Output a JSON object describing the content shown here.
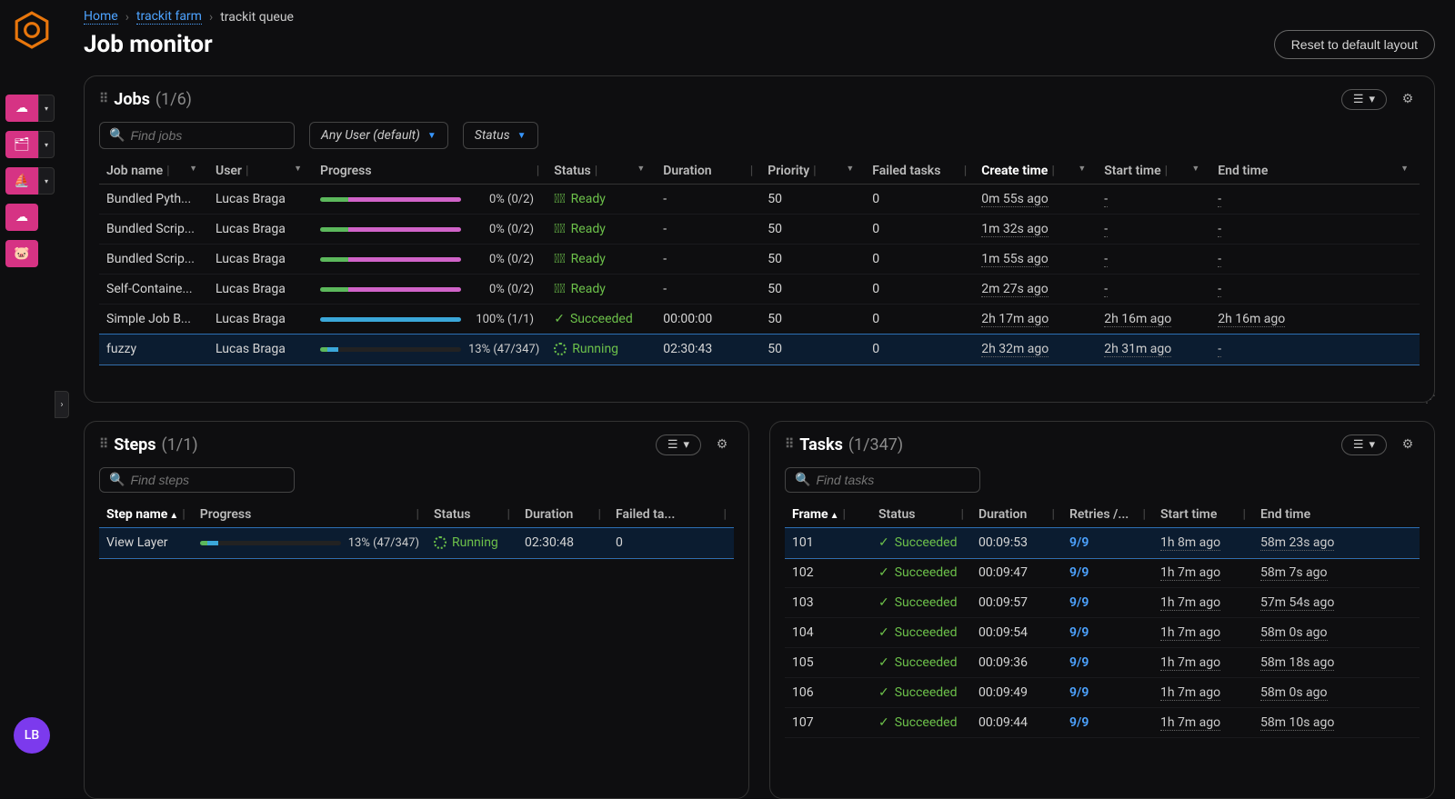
{
  "breadcrumb": {
    "home": "Home",
    "farm": "trackit farm",
    "queue": "trackit queue"
  },
  "page_title": "Job monitor",
  "reset_button": "Reset to default layout",
  "avatar_initials": "LB",
  "jobs_panel": {
    "title": "Jobs",
    "count": "(1/6)",
    "search_placeholder": "Find jobs",
    "user_filter": "Any User (default)",
    "status_filter": "Status",
    "cols": {
      "name": "Job name",
      "user": "User",
      "progress": "Progress",
      "status": "Status",
      "duration": "Duration",
      "priority": "Priority",
      "failed": "Failed tasks",
      "create": "Create time",
      "start": "Start time",
      "end": "End time"
    },
    "rows": [
      {
        "name": "Bundled Pyth...",
        "user": "Lucas Braga",
        "prog": "0% (0/2)",
        "status": "Ready",
        "icon": "ready",
        "bar": {
          "g": 20,
          "p": 80,
          "b": 0
        },
        "dur": "-",
        "pri": "50",
        "fail": "0",
        "create": "0m 55s ago",
        "start": "-",
        "end": "-"
      },
      {
        "name": "Bundled Scrip...",
        "user": "Lucas Braga",
        "prog": "0% (0/2)",
        "status": "Ready",
        "icon": "ready",
        "bar": {
          "g": 20,
          "p": 80,
          "b": 0
        },
        "dur": "-",
        "pri": "50",
        "fail": "0",
        "create": "1m 32s ago",
        "start": "-",
        "end": "-"
      },
      {
        "name": "Bundled Scrip...",
        "user": "Lucas Braga",
        "prog": "0% (0/2)",
        "status": "Ready",
        "icon": "ready",
        "bar": {
          "g": 20,
          "p": 80,
          "b": 0
        },
        "dur": "-",
        "pri": "50",
        "fail": "0",
        "create": "1m 55s ago",
        "start": "-",
        "end": "-"
      },
      {
        "name": "Self-Containe...",
        "user": "Lucas Braga",
        "prog": "0% (0/2)",
        "status": "Ready",
        "icon": "ready",
        "bar": {
          "g": 20,
          "p": 80,
          "b": 0
        },
        "dur": "-",
        "pri": "50",
        "fail": "0",
        "create": "2m 27s ago",
        "start": "-",
        "end": "-"
      },
      {
        "name": "Simple Job B...",
        "user": "Lucas Braga",
        "prog": "100% (1/1)",
        "status": "Succeeded",
        "icon": "succeeded",
        "bar": {
          "g": 0,
          "p": 0,
          "b": 100
        },
        "dur": "00:00:00",
        "pri": "50",
        "fail": "0",
        "create": "2h 17m ago",
        "start": "2h 16m ago",
        "end": "2h 16m ago"
      },
      {
        "name": "fuzzy",
        "user": "Lucas Braga",
        "prog": "13% (47/347)",
        "status": "Running",
        "icon": "running",
        "bar": {
          "g": 5,
          "p": 0,
          "b": 8,
          "e": 87
        },
        "dur": "02:30:43",
        "pri": "50",
        "fail": "0",
        "create": "2h 32m ago",
        "start": "2h 31m ago",
        "end": "-",
        "selected": true
      }
    ]
  },
  "steps_panel": {
    "title": "Steps",
    "count": "(1/1)",
    "search_placeholder": "Find steps",
    "cols": {
      "name": "Step name",
      "progress": "Progress",
      "status": "Status",
      "duration": "Duration",
      "failed": "Failed ta..."
    },
    "rows": [
      {
        "name": "View Layer",
        "prog": "13% (47/347)",
        "status": "Running",
        "icon": "running",
        "bar": {
          "g": 5,
          "p": 0,
          "b": 8,
          "e": 87
        },
        "dur": "02:30:48",
        "fail": "0",
        "selected": true
      }
    ]
  },
  "tasks_panel": {
    "title": "Tasks",
    "count": "(1/347)",
    "search_placeholder": "Find tasks",
    "cols": {
      "frame": "Frame",
      "status": "Status",
      "duration": "Duration",
      "retries": "Retries /...",
      "start": "Start time",
      "end": "End time"
    },
    "rows": [
      {
        "frame": "101",
        "status": "Succeeded",
        "dur": "00:09:53",
        "retries": "9/9",
        "start": "1h 8m ago",
        "end": "58m 23s ago",
        "selected": true
      },
      {
        "frame": "102",
        "status": "Succeeded",
        "dur": "00:09:47",
        "retries": "9/9",
        "start": "1h 7m ago",
        "end": "58m 7s ago"
      },
      {
        "frame": "103",
        "status": "Succeeded",
        "dur": "00:09:57",
        "retries": "9/9",
        "start": "1h 7m ago",
        "end": "57m 54s ago"
      },
      {
        "frame": "104",
        "status": "Succeeded",
        "dur": "00:09:54",
        "retries": "9/9",
        "start": "1h 7m ago",
        "end": "58m 0s ago"
      },
      {
        "frame": "105",
        "status": "Succeeded",
        "dur": "00:09:36",
        "retries": "9/9",
        "start": "1h 7m ago",
        "end": "58m 18s ago"
      },
      {
        "frame": "106",
        "status": "Succeeded",
        "dur": "00:09:49",
        "retries": "9/9",
        "start": "1h 7m ago",
        "end": "58m 0s ago"
      },
      {
        "frame": "107",
        "status": "Succeeded",
        "dur": "00:09:44",
        "retries": "9/9",
        "start": "1h 7m ago",
        "end": "58m 10s ago"
      }
    ]
  }
}
